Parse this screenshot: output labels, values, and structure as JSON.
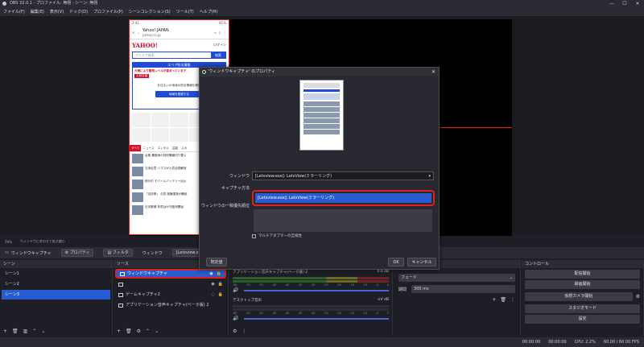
{
  "window": {
    "title": "OBS 32.0.1 - プロファイル: 無題 - シーン: 無題",
    "minimize": "—",
    "maximize": "☐",
    "close": "✕"
  },
  "menu": [
    "ファイル(F)",
    "編集(E)",
    "表示(V)",
    "ドック(D)",
    "プロファイル(P)",
    "シーンコレクション(S)",
    "ツール(T)",
    "ヘルプ(H)"
  ],
  "phone": {
    "time": "2:41",
    "battery": "81%",
    "site_title": "Yahoo! JAPAN",
    "site_url": "yahoo.co.jp",
    "logo": "YAHOO!",
    "login": "ログイン",
    "search_placeholder": "アニメで検索",
    "search_button": "検索",
    "alert_head": "エリア防災情報",
    "alert_text": "大雨により警戒レベルが高まっています",
    "alert_tag": "土砂災害",
    "alert_sub": "お住まいの地域の防災情報を確認",
    "alert_cta": "地域を登録する",
    "tabs": [
      "すべて",
      "ニュース",
      "エンタメ",
      "芸能",
      "スポ"
    ],
    "news": [
      "台風 暴風雨の特別警報切り替え",
      "交渉合意 ハマスが人質全員解放",
      "飛行中 モバイルバッテリー出火",
      "「支持率」 与党 政権運営が難航",
      "日本郵便 年賀はがき販売開始"
    ]
  },
  "preview": {
    "zoom": "59%",
    "fit_label": "ウィンドウに合わせて拡大縮小"
  },
  "source_toolbar": {
    "source_name": "ウィンドウキャプチャ",
    "properties": "プロパティ",
    "filters": "フィルタ",
    "window_label": "ウィンドウ",
    "window_value": "[Letsview.exe]: LetsView"
  },
  "scenes": {
    "title": "シーン",
    "items": [
      "シーン1",
      "シーン2",
      "シーン3"
    ],
    "selected": 2
  },
  "sources": {
    "title": "ソース",
    "items": [
      "ウィンドウキャプチャ",
      "",
      "ゲームキャプチャ2",
      "アプリケーション音声キャプチャ(ベータ版) 2"
    ]
  },
  "mixer": {
    "channel1": "アプリケーション音声キャプチャ(ベータ版) 2",
    "channel1_db": "0.0 dB",
    "channel2": "デスクトップ音声",
    "channel2_db": "-inf dB",
    "ticks": [
      "-60",
      "-55",
      "-50",
      "-45",
      "-40",
      "-35",
      "-30",
      "-25",
      "-20",
      "-15",
      "-10",
      "-5",
      "0"
    ]
  },
  "transitions": {
    "fade": "フェード",
    "duration_label": "期間",
    "duration_value": "300 ms"
  },
  "controls": {
    "title": "コントロール",
    "buttons": [
      "配信開始",
      "録画開始",
      "仮想カメラ開始",
      "スタジオモード",
      "設定"
    ]
  },
  "status": {
    "time1": "00:00:00",
    "time2": "00:00:00",
    "cpu": "CPU: 2.2%",
    "fps": "60.00 / 60.00 FPS"
  },
  "dialog": {
    "title": "'ウィンドウキャプチャ' のプロパティ",
    "window_label": "ウィンドウ",
    "capture_label": "キャプチャ方法",
    "priority_label": "ウィンドウの一致優先順位",
    "window_value": "[Letsview.exe]: LetsView(ミラーリング)",
    "dropdown_selected": "[Letsview.exe]: LetsView(ミラーリング)",
    "checkbox_label": "マルチアダプターの互換性",
    "defaults_button": "既定値",
    "ok_button": "OK",
    "cancel_button": "キャンセル"
  },
  "colors": {
    "accent": "#2a5cd1",
    "highlight_red": "#e02020"
  }
}
